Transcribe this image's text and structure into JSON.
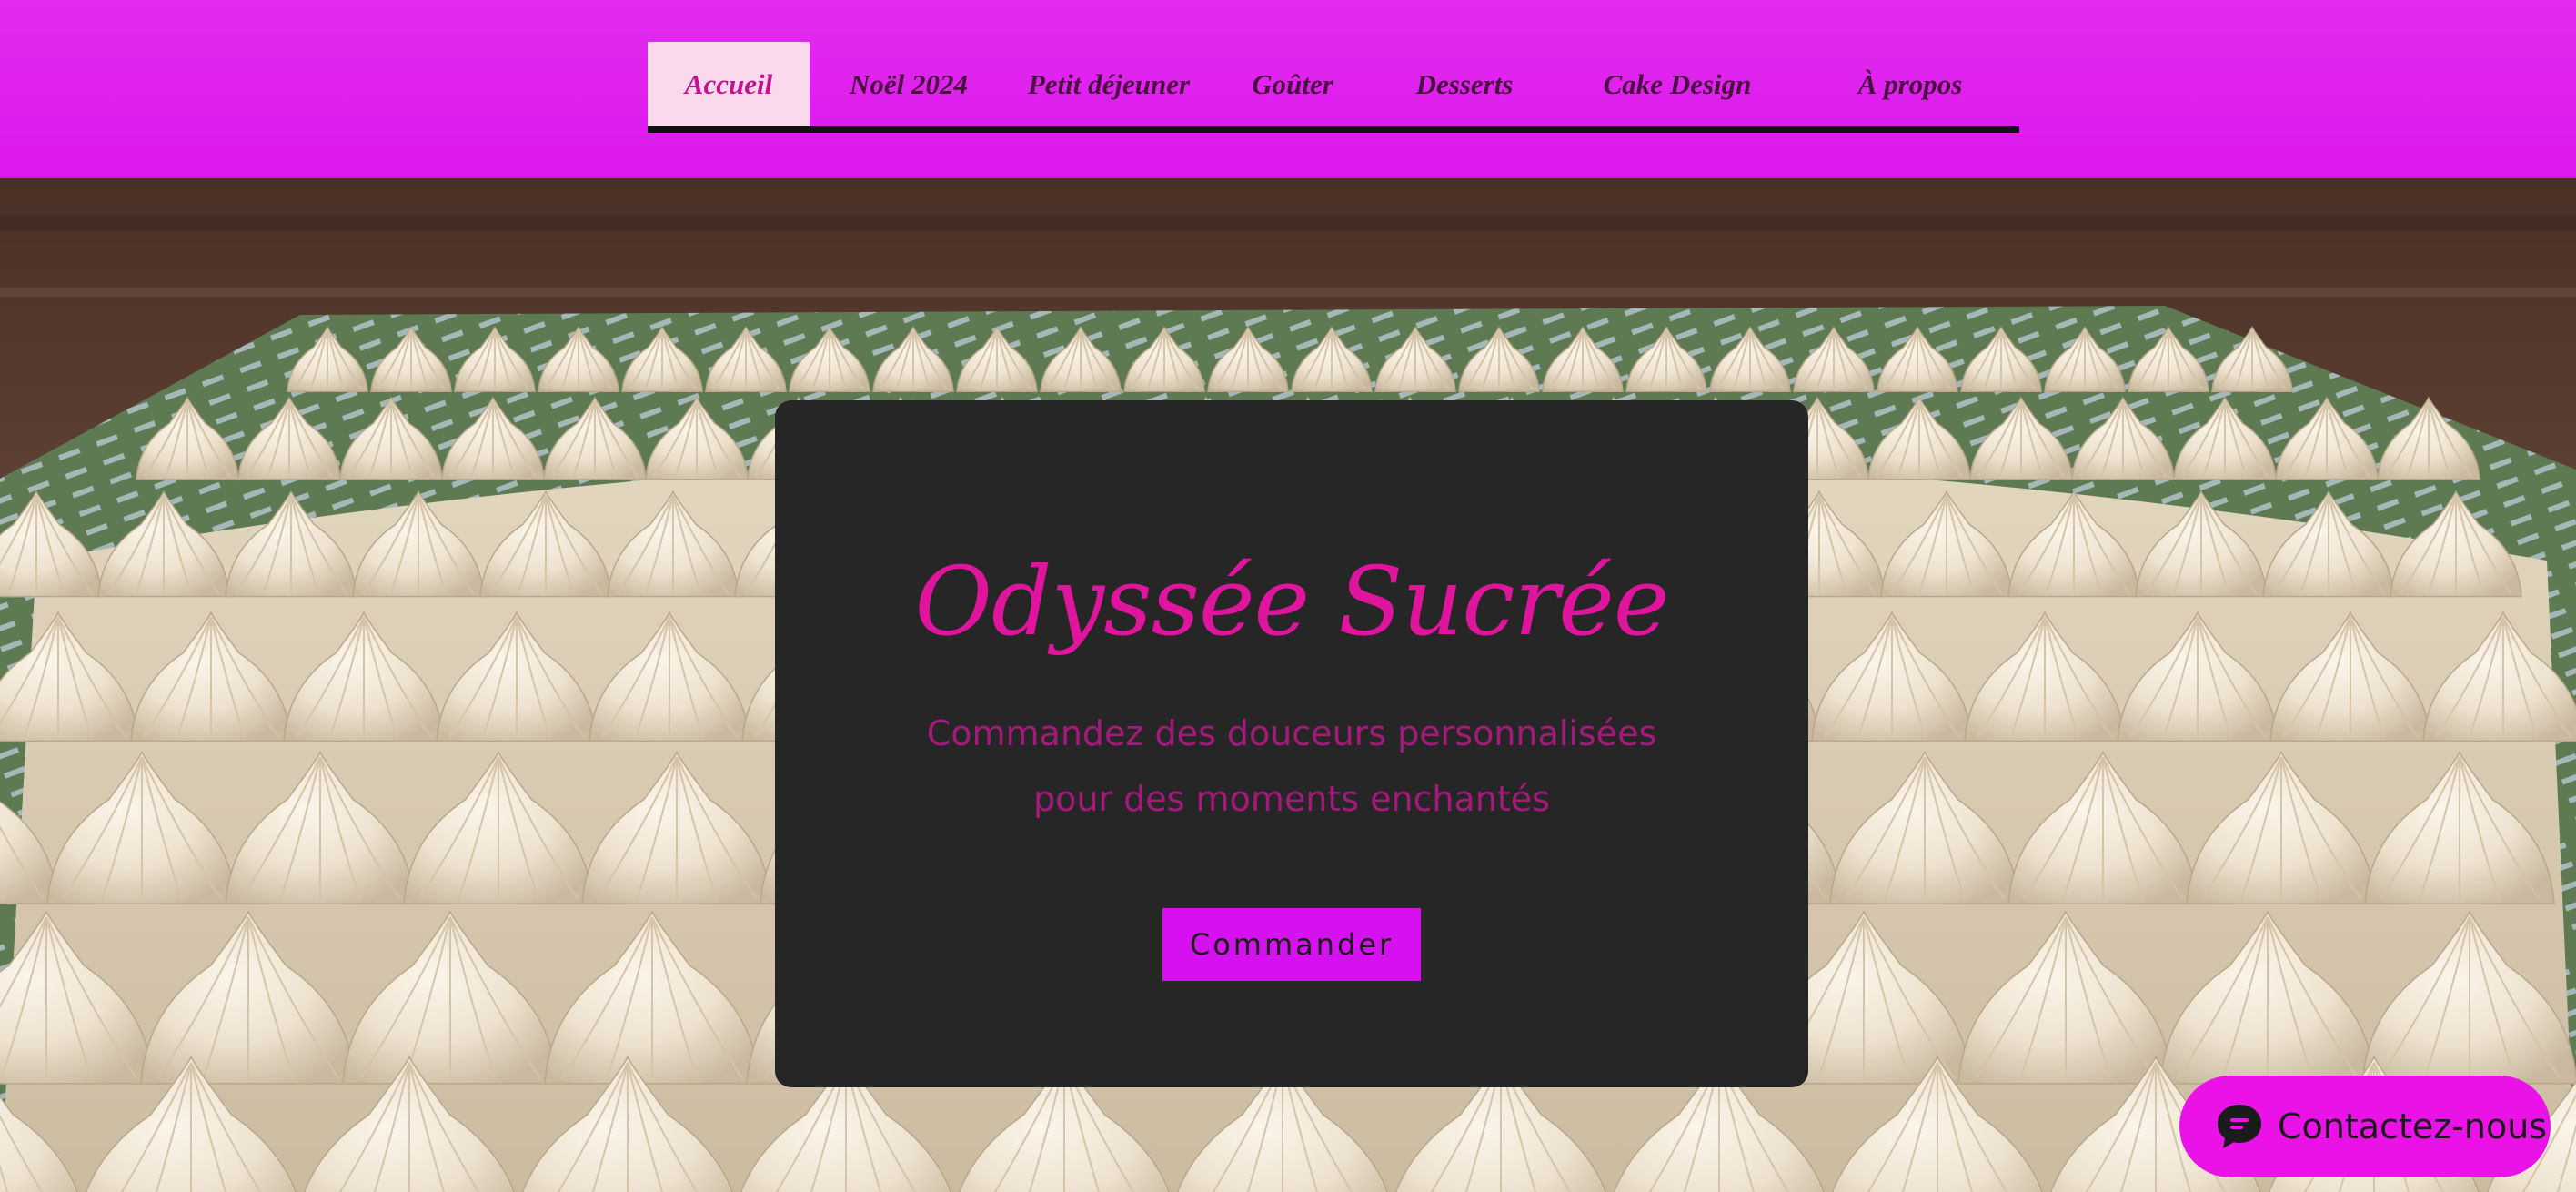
{
  "colors": {
    "header_bg": "#dc18ee",
    "nav_active_bg": "#fbd9ec",
    "nav_active_text": "#c4128f",
    "nav_text": "#4a1140",
    "card_bg": "#262626",
    "title": "#e0159e",
    "subtitle": "#a31a7b",
    "button_bg": "#d611f0",
    "chat_bg": "#ea12e6"
  },
  "nav": {
    "items": [
      {
        "label": "Accueil",
        "active": true
      },
      {
        "label": "Noël 2024",
        "active": false
      },
      {
        "label": "Petit déjeuner",
        "active": false
      },
      {
        "label": "Goûter",
        "active": false
      },
      {
        "label": "Desserts",
        "active": false
      },
      {
        "label": "Cake Design",
        "active": false
      },
      {
        "label": "À propos",
        "active": false
      }
    ]
  },
  "hero": {
    "background_image": "piped cream meringue tart on a green tray, wooden background"
  },
  "card": {
    "title": "Odyssée Sucrée",
    "subtitle_line1": "Commandez des douceurs personnalisées",
    "subtitle_line2": "pour des moments enchantés",
    "button_label": "Commander"
  },
  "chat": {
    "label": "Contactez-nous",
    "icon": "chat-bubble-icon"
  }
}
